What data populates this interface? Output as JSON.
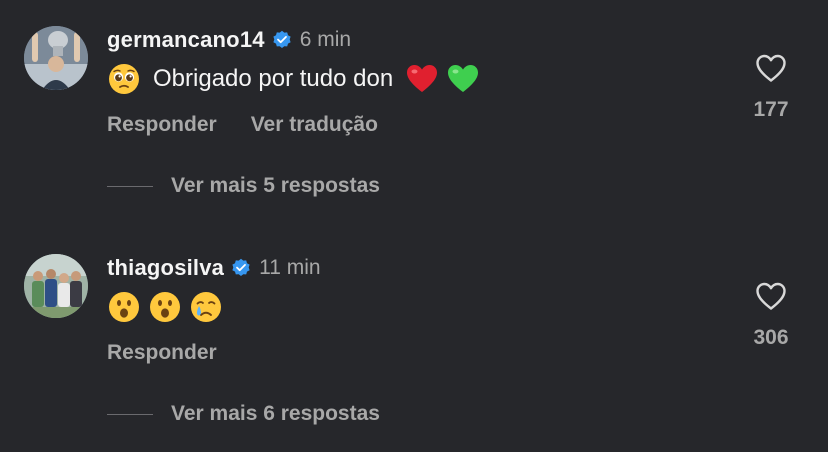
{
  "comments": [
    {
      "username": "germancano14",
      "verified": true,
      "time": "6 min",
      "text": "Obrigado por tudo don",
      "emojis_before": [
        "pleading-face"
      ],
      "emojis_after": [
        "red-heart",
        "green-heart"
      ],
      "actions": [
        "Responder",
        "Ver tradução"
      ],
      "likes": "177",
      "replies": "Ver mais 5 respostas"
    },
    {
      "username": "thiagosilva",
      "verified": true,
      "time": "11 min",
      "text": "",
      "emojis": [
        "face-with-open-mouth",
        "face-with-open-mouth",
        "crying-face"
      ],
      "actions": [
        "Responder"
      ],
      "likes": "306",
      "replies": "Ver mais 6 respostas"
    }
  ],
  "colors": {
    "background": "#26272b",
    "primary_text": "#f5f5f5",
    "secondary_text": "#a8a8a8",
    "verified_badge": "#3797f0"
  }
}
